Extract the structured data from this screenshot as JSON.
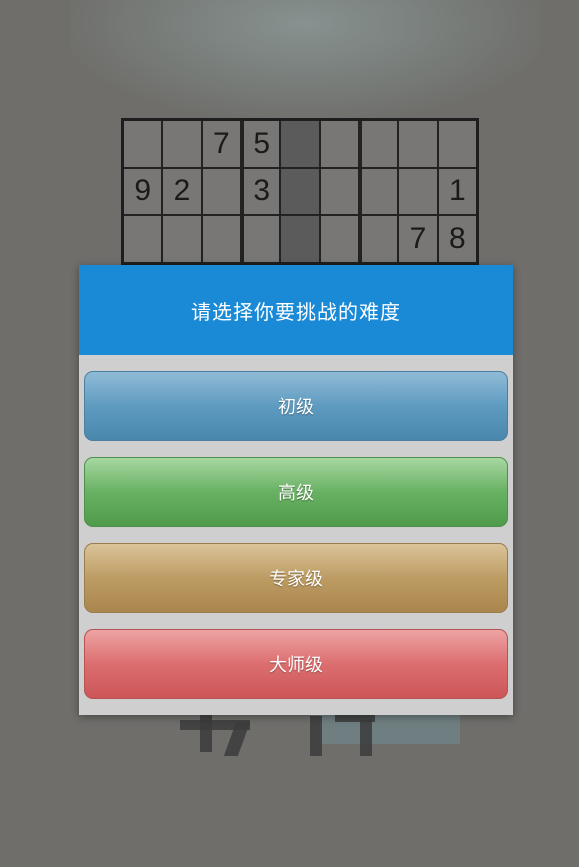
{
  "board": {
    "rows": [
      [
        "",
        "",
        "7",
        "5",
        "",
        "",
        "",
        "",
        ""
      ],
      [
        "9",
        "2",
        "",
        "3",
        "",
        "",
        "",
        "",
        "1"
      ],
      [
        "",
        "",
        "",
        "",
        "",
        "",
        "",
        "7",
        "8"
      ]
    ]
  },
  "dialog": {
    "title": "请选择你要挑战的难度",
    "options": [
      {
        "label": "初级"
      },
      {
        "label": "高级"
      },
      {
        "label": "专家级"
      },
      {
        "label": "大师级"
      }
    ]
  },
  "colors": {
    "header": "#1b8ad6",
    "beginner": "#5f9bc0",
    "advanced": "#68b163",
    "expert": "#bd9c64",
    "master": "#dc6e70"
  }
}
